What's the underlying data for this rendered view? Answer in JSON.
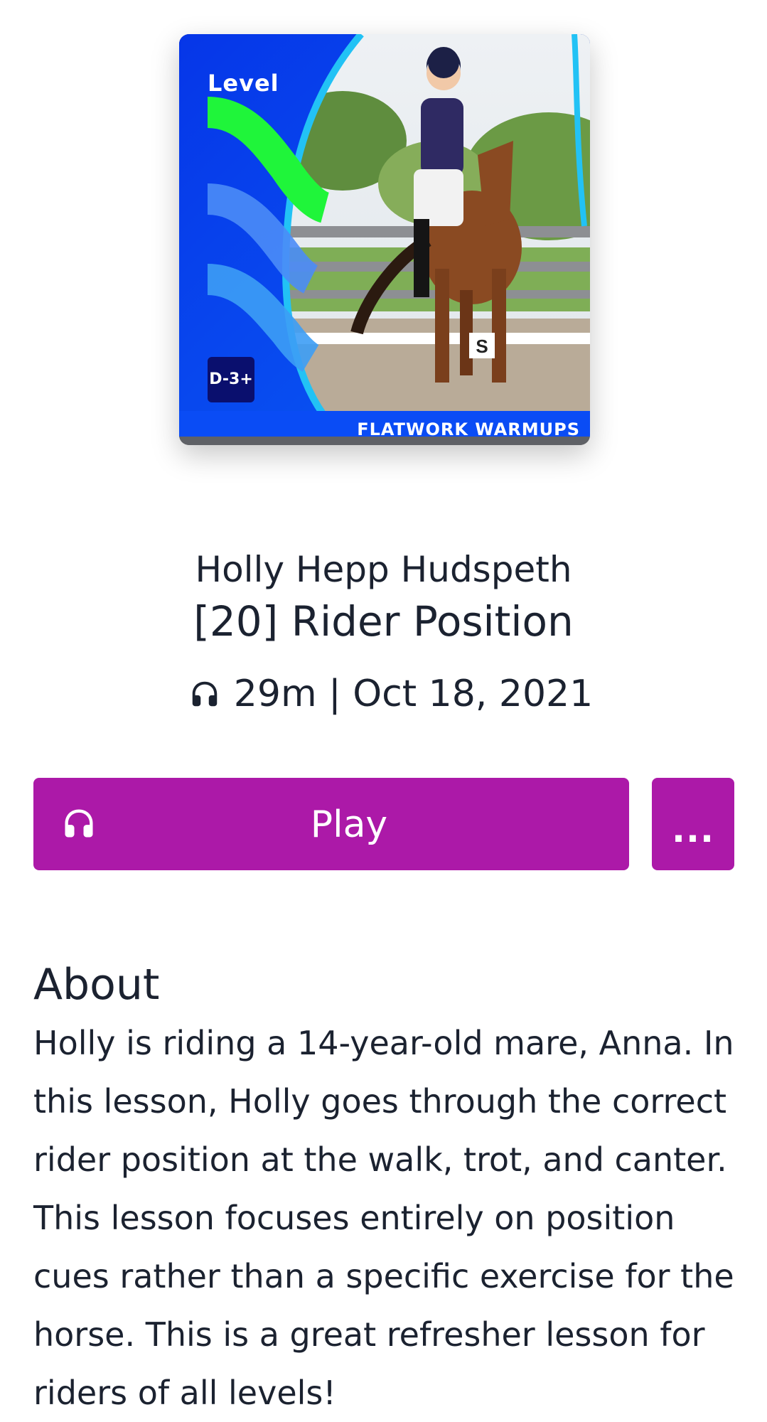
{
  "cover": {
    "level_label": "Level",
    "badge": "D-3+",
    "series": "FLATWORK WARMUPS",
    "accent_color": "#0a4cf5",
    "highlight_color": "#1ff53a"
  },
  "episode": {
    "author": "Holly Hepp Hudspeth",
    "title": "[20] Rider Position",
    "meta": "29m | Oct 18, 2021"
  },
  "actions": {
    "play_label": "Play",
    "more_label": "...",
    "button_color": "#ac19a8"
  },
  "about": {
    "heading": "About",
    "text": "Holly is riding a 14-year-old mare, Anna. In this lesson, Holly goes through the correct rider position at the walk, trot, and canter. This lesson focuses entirely on position cues rather than a specific exercise for the horse. This is a great refresher lesson for riders of all levels!"
  },
  "icons": {
    "meta_icon": "headphones-icon",
    "play_icon": "headphones-icon"
  }
}
